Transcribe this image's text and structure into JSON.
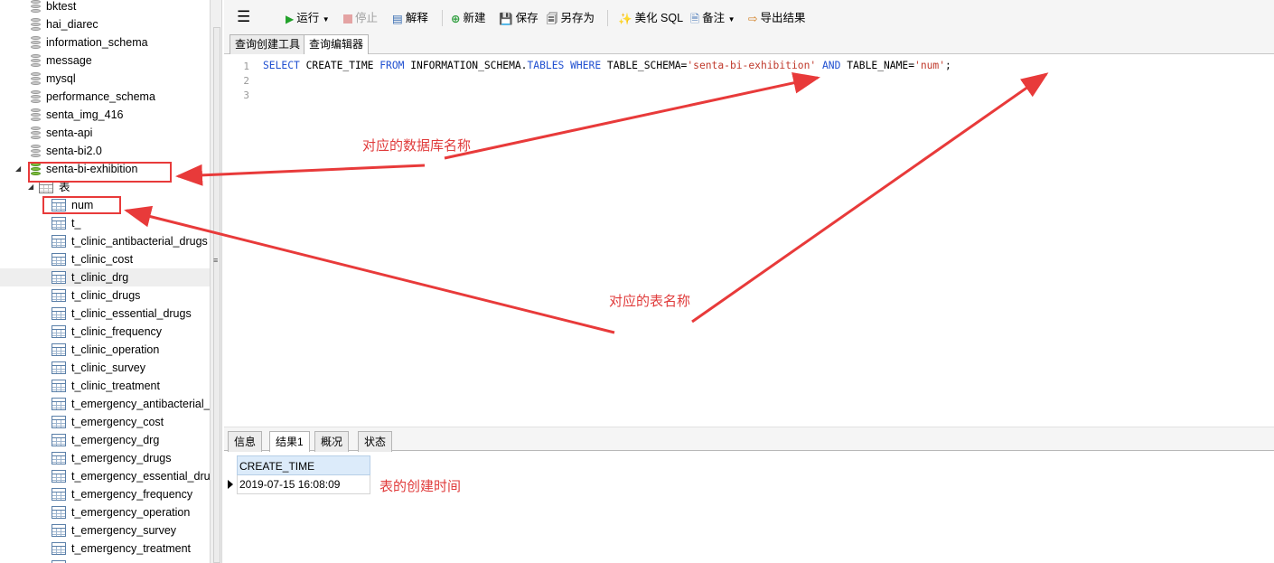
{
  "tree": {
    "databases": [
      "bktest",
      "hai_diarec",
      "information_schema",
      "message",
      "mysql",
      "performance_schema",
      "senta_img_416",
      "senta-api",
      "senta-bi2.0"
    ],
    "open_database": "senta-bi-exhibition",
    "group_label": "表",
    "tables": [
      "num",
      "t_",
      "t_clinic_antibacterial_drugs",
      "t_clinic_cost",
      "t_clinic_drg",
      "t_clinic_drugs",
      "t_clinic_essential_drugs",
      "t_clinic_frequency",
      "t_clinic_operation",
      "t_clinic_survey",
      "t_clinic_treatment",
      "t_emergency_antibacterial_",
      "t_emergency_cost",
      "t_emergency_drg",
      "t_emergency_drugs",
      "t_emergency_essential_dru",
      "t_emergency_frequency",
      "t_emergency_operation",
      "t_emergency_survey",
      "t_emergency_treatment"
    ],
    "selected_table": "t_clinic_drg"
  },
  "toolbar": {
    "menu_icon": "hamburger-icon",
    "run": "运行",
    "stop": "停止",
    "explain": "解释",
    "new": "新建",
    "save": "保存",
    "save_as": "另存为",
    "beautify": "美化 SQL",
    "comment": "备注",
    "export": "导出结果"
  },
  "editor_tabs": [
    "查询创建工具",
    "查询编辑器"
  ],
  "editor": {
    "line_numbers": [
      "1",
      "2",
      "3"
    ],
    "sql_tokens": {
      "select": "SELECT",
      "col": " CREATE_TIME ",
      "from": "FROM",
      "schema": " INFORMATION_SCHEMA.",
      "tables": "TABLES",
      "sp": " ",
      "where": "WHERE",
      "cond1": " TABLE_SCHEMA=",
      "val1": "'senta-bi-exhibition'",
      "and": "AND",
      "cond2": " TABLE_NAME=",
      "val2": "'num'",
      "end": ";"
    }
  },
  "result_tabs": [
    "信息",
    "结果1",
    "概况",
    "状态"
  ],
  "result_grid": {
    "column": "CREATE_TIME",
    "value": "2019-07-15 16:08:09"
  },
  "annotations": {
    "db_name_note": "对应的数据库名称",
    "table_name_note": "对应的表名称",
    "create_time_note": "表的创建时间"
  },
  "colors": {
    "annotation_red": "#e83a3a",
    "keyword_blue": "#1f4fd0",
    "string_red": "#c0392b",
    "header_blue": "#dcebfa"
  }
}
